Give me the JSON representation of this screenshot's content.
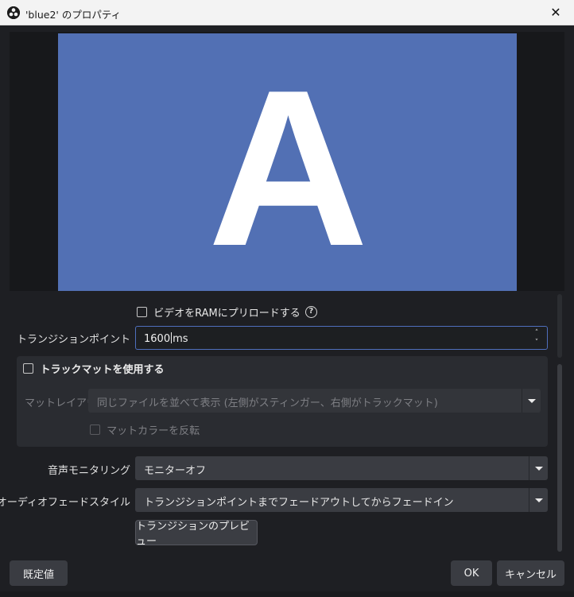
{
  "window": {
    "title": "'blue2' のプロパティ",
    "close_glyph": "✕",
    "app_icon": "obs-icon"
  },
  "preview": {
    "letter": "A",
    "source_color": "#5270b4",
    "background_color": "#17181b"
  },
  "preload": {
    "label": "ビデオをRAMにプリロードする",
    "checked": false,
    "help_glyph": "?"
  },
  "transition_point": {
    "label": "トランジションポイント",
    "value": "1600",
    "unit": "ms",
    "arrow_up": "˄",
    "arrow_down": "˅"
  },
  "track_matte": {
    "title": "トラックマットを使用する",
    "checked": false,
    "layout_label": "マットレイアウト",
    "layout_value": "同じファイルを並べて表示 (左側がスティンガー、右側がトラックマット)",
    "invert_label": "マットカラーを反転",
    "invert_checked": false
  },
  "audio_monitoring": {
    "label": "音声モニタリング",
    "value": "モニターオフ"
  },
  "audio_fade": {
    "label": "オーディオフェードスタイル",
    "value": "トランジションポイントまでフェードアウトしてからフェードイン"
  },
  "preview_button": "トランジションのプレビュー",
  "footer": {
    "defaults_button": "既定値",
    "ok_button": "OK",
    "cancel_button": "キャンセル"
  },
  "colors": {
    "accent_border": "#4f6fbd",
    "panel_bg": "#1e1f23",
    "control_bg": "#3a3c42"
  }
}
